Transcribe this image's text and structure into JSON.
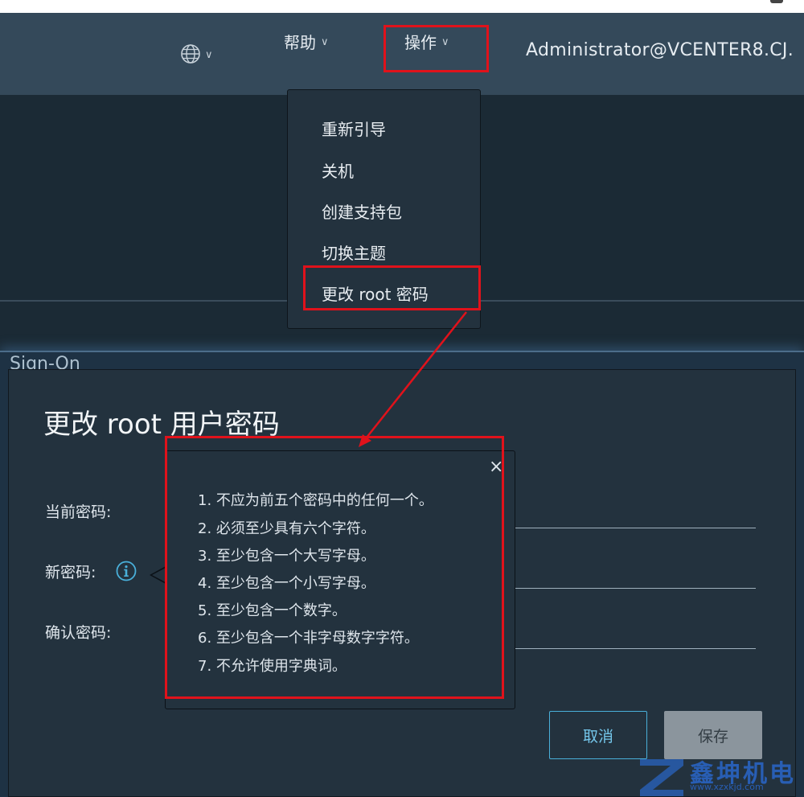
{
  "header": {
    "language_icon": "globe-icon",
    "help_label": "帮助",
    "actions_label": "操作",
    "user_label": "Administrator@VCENTER8.CJ."
  },
  "actions_menu": {
    "items": [
      {
        "label": "重新引导"
      },
      {
        "label": "关机"
      },
      {
        "label": "创建支持包"
      },
      {
        "label": "切换主题"
      },
      {
        "label": "更改 root 密码"
      }
    ]
  },
  "background": {
    "panel_title": "Sign-On"
  },
  "dialog": {
    "title": "更改 root 用户密码",
    "current_password_label": "当前密码:",
    "new_password_label": "新密码:",
    "confirm_password_label": "确认密码:",
    "cancel_label": "取消",
    "save_label": "保存"
  },
  "password_tooltip": {
    "close_glyph": "×",
    "rules": [
      "1. 不应为前五个密码中的任何一个。",
      "2. 必须至少具有六个字符。",
      "3. 至少包含一个大写字母。",
      "4. 至少包含一个小写字母。",
      "5. 至少包含一个数字。",
      "6. 至少包含一个非字母数字字符。",
      "7. 不允许使用字典词。"
    ]
  },
  "watermark": {
    "text": "鑫坤机电",
    "url": "www.xzxkjd.com"
  },
  "colors": {
    "header_bg": "#34495a",
    "dialog_bg": "#23323e",
    "accent": "#49afd9",
    "annotation_red": "#e0121b"
  }
}
